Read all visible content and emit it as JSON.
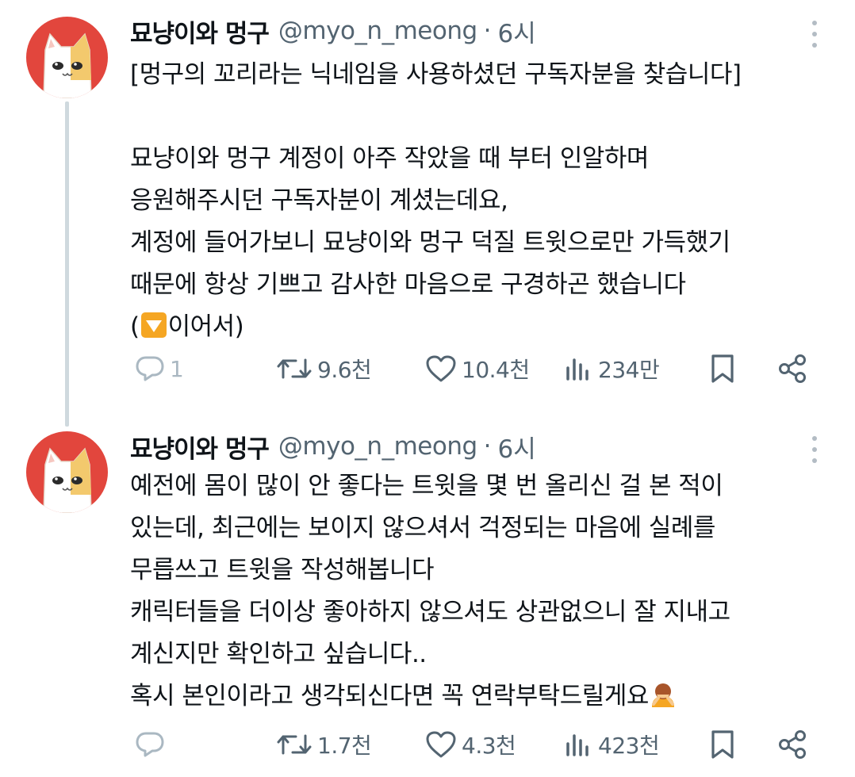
{
  "tweets": [
    {
      "name": "묘냥이와 멍구",
      "handle": "@myo_n_meong",
      "separator": "·",
      "time": "6시",
      "lines": [
        "[멍구의 꼬리라는 닉네임을 사용하셨던 구독자분을 찾습니다]",
        "",
        "묘냥이와 멍구 계정이 아주 작았을 때 부터 인알하며",
        "응원해주시던 구독자분이 계셨는데요,",
        "계정에 들어가보니 묘냥이와 멍구 덕질 트윗으로만 가득했기",
        "때문에 항상 기쁘고 감사한 마음으로 구경하곤 했습니다",
        "(",
        "이어서)"
      ],
      "reply_count": "1",
      "retweet_count": "9.6천",
      "like_count": "10.4천",
      "view_count": "234만"
    },
    {
      "name": "묘냥이와 멍구",
      "handle": "@myo_n_meong",
      "separator": "·",
      "time": "6시",
      "lines": [
        "예전에 몸이 많이 안 좋다는 트윗을 몇 번 올리신 걸 본 적이",
        "있는데, 최근에는 보이지 않으셔서 걱정되는 마음에 실례를",
        "무릅쓰고 트윗을 작성해봅니다",
        "캐릭터들을 더이상 좋아하지 않으셔도 상관없으니 잘 지내고",
        "계신지만 확인하고 싶습니다..",
        "혹시 본인이라고 생각되신다면 꼭 연락부탁드릴게요"
      ],
      "reply_count": "",
      "retweet_count": "1.7천",
      "like_count": "4.3천",
      "view_count": "423천"
    }
  ],
  "icons": {
    "reply": "reply-bubble-icon",
    "retweet": "retweet-icon",
    "like": "heart-icon",
    "views": "analytics-bars-icon",
    "bookmark": "bookmark-icon",
    "share": "share-icon",
    "more": "more-vertical-icon",
    "down_arrow": "down-arrow-emoji",
    "bowing": "person-bowing-emoji"
  },
  "colors": {
    "text": "#0f1419",
    "secondary": "#536471",
    "avatar_bg": "#e2463d",
    "thread_line": "#cfd9de",
    "emoji_orange": "#f5a623"
  }
}
